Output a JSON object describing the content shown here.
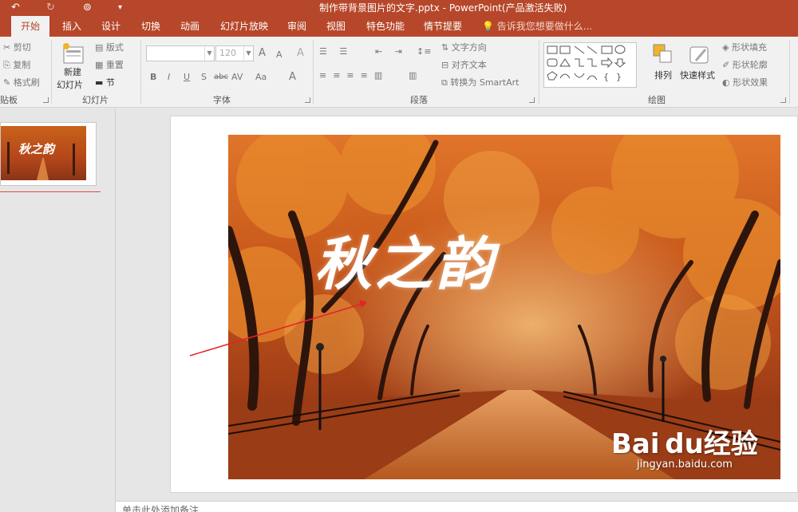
{
  "titlebar": {
    "title": "制作带背景图片的文字.pptx - PowerPoint(产品激活失败)",
    "qa_undo": "↶",
    "qa_redo": "↻",
    "qa_present": "⊚",
    "qa_more": "▾"
  },
  "tabs": [
    {
      "label": "开始",
      "active": true
    },
    {
      "label": "插入"
    },
    {
      "label": "设计"
    },
    {
      "label": "切换"
    },
    {
      "label": "动画"
    },
    {
      "label": "幻灯片放映"
    },
    {
      "label": "审阅"
    },
    {
      "label": "视图"
    },
    {
      "label": "特色功能"
    },
    {
      "label": "情节提要"
    }
  ],
  "tellme": "告诉我您想要做什么...",
  "ribbon": {
    "clipboard": {
      "cut": "剪切",
      "copy": "复制",
      "painter": "格式刷",
      "label": "贴板"
    },
    "slides": {
      "new_line1": "新建",
      "new_line2": "幻灯片",
      "layout": "版式",
      "reset": "重置",
      "section": "节",
      "label": "幻灯片"
    },
    "font": {
      "size": "120",
      "grow": "A",
      "shrink": "A",
      "clear": "A",
      "bold": "B",
      "italic": "I",
      "underline": "U",
      "shadow": "S",
      "strike": "abc",
      "spacing": "AV",
      "case": "Aa",
      "color": "A",
      "label": "字体"
    },
    "paragraph": {
      "text_dir": "文字方向",
      "align_text": "对齐文本",
      "smartart": "转换为 SmartArt",
      "label": "段落"
    },
    "drawing": {
      "arrange": "排列",
      "quick_styles": "快速样式",
      "fill": "形状填充",
      "outline": "形状轮廓",
      "effects": "形状效果",
      "label": "绘图"
    }
  },
  "slide": {
    "title": "秋之韵",
    "thumb_title": "秋之韵",
    "watermark_brand": "Bai du经验",
    "watermark_url": "jingyan.baidu.com"
  },
  "notes": {
    "placeholder": "单击此处添加备注"
  },
  "colors": {
    "accent": "#b7472a",
    "ribbon": "#f1f1f1",
    "workspace": "#e6e6e6",
    "arrow": "#e8212a"
  }
}
